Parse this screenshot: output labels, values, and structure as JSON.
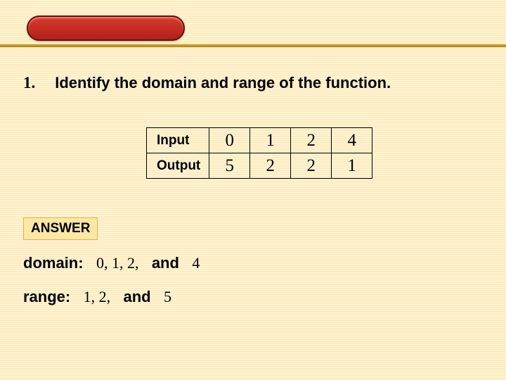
{
  "question": {
    "number": "1.",
    "text": "Identify the domain and range of the function."
  },
  "table": {
    "rowLabels": [
      "Input",
      "Output"
    ],
    "inputs": [
      "0",
      "1",
      "2",
      "4"
    ],
    "outputs": [
      "5",
      "2",
      "2",
      "1"
    ]
  },
  "answer": {
    "tag": "ANSWER",
    "domain": {
      "label": "domain:",
      "values": "0, 1, 2,",
      "and": "and",
      "last": "4"
    },
    "range": {
      "label": "range:",
      "values": "1, 2,",
      "and": "and",
      "last": "5"
    }
  }
}
